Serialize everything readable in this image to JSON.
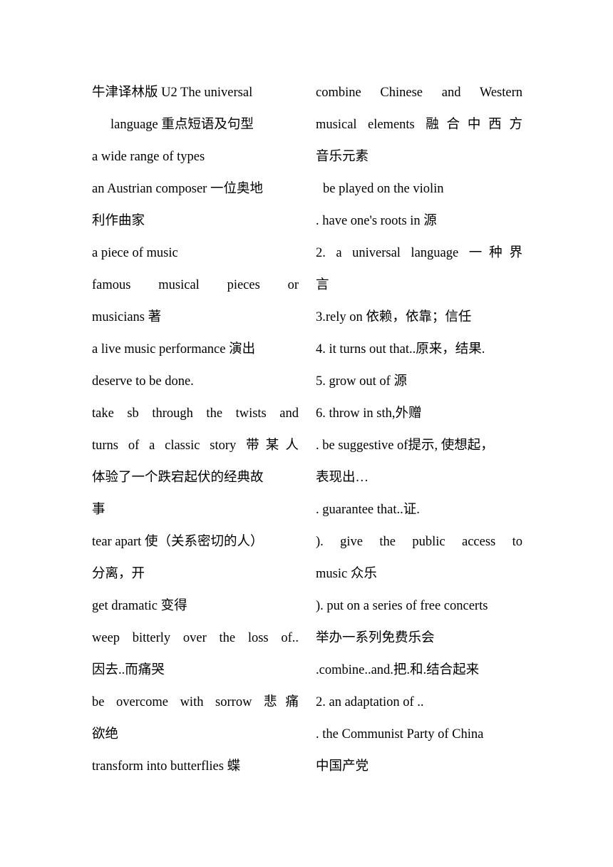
{
  "document": {
    "title_lines": [
      "牛津译林版 U2 The universal",
      "language 重点短语及句型"
    ],
    "left_column": [
      {
        "text": "牛津译林版 U2 The universal",
        "style": "title"
      },
      {
        "text": "language 重点短语及句型",
        "style": "title-indent"
      },
      {
        "text": "a wide range of types",
        "style": "plain"
      },
      {
        "text": "an Austrian composer 一位奥地",
        "style": "plain"
      },
      {
        "text": "利作曲家",
        "style": "plain"
      },
      {
        "text": "a piece of music",
        "style": "plain"
      },
      {
        "text": "famous musical pieces or",
        "style": "justify"
      },
      {
        "text": "musicians 著",
        "style": "plain"
      },
      {
        "text": "a live music performance 演出",
        "style": "plain"
      },
      {
        "text": "deserve to be done.",
        "style": "plain"
      },
      {
        "text": "take sb through the twists and",
        "style": "justify"
      },
      {
        "text": "turns of a classic story 带某人",
        "style": "justify"
      },
      {
        "text": "体验了一个跌宕起伏的经典故",
        "style": "plain"
      },
      {
        "text": "事",
        "style": "plain"
      },
      {
        "text": "tear apart 使（关系密切的人）",
        "style": "plain"
      },
      {
        "text": "分离，开",
        "style": "plain"
      },
      {
        "text": "get dramatic 变得",
        "style": "plain"
      },
      {
        "text": "weep bitterly over the loss of..",
        "style": "justify"
      },
      {
        "text": "因去..而痛哭",
        "style": "plain"
      },
      {
        "text": "be overcome with sorrow 悲痛",
        "style": "justify"
      },
      {
        "text": "欲绝",
        "style": "plain"
      },
      {
        "text": "transform into butterflies 蝶",
        "style": "plain"
      }
    ],
    "right_column": [
      {
        "text": "combine Chinese and Western",
        "style": "justify"
      },
      {
        "text": "musical elements 融合中西方",
        "style": "justify"
      },
      {
        "text": "音乐元素",
        "style": "plain"
      },
      {
        "text": "be played on the violin",
        "style": "indent-small"
      },
      {
        "text": ". have one's roots in 源",
        "style": "plain"
      },
      {
        "text": "2. a universal language 一种界",
        "style": "justify"
      },
      {
        "text": "言",
        "style": "plain"
      },
      {
        "text": "3.rely on 依赖，依靠；信任",
        "style": "plain"
      },
      {
        "text": "4. it turns out that..原来，结果.",
        "style": "plain"
      },
      {
        "text": "5. grow out of 源",
        "style": "plain"
      },
      {
        "text": "6. throw in sth,外赠",
        "style": "plain"
      },
      {
        "text": ". be suggestive of提示, 使想起，",
        "style": "plain"
      },
      {
        "text": "表现出…",
        "style": "plain"
      },
      {
        "text": ". guarantee that..证.",
        "style": "plain"
      },
      {
        "text": "). give the public access to",
        "style": "justify"
      },
      {
        "text": "music 众乐",
        "style": "plain"
      },
      {
        "text": "). put on a series of free concerts",
        "style": "plain"
      },
      {
        "text": "举办一系列免费乐会",
        "style": "plain"
      },
      {
        "text": ".combine..and.把.和.结合起来",
        "style": "plain"
      },
      {
        "text": "2. an adaptation of ..",
        "style": "plain"
      },
      {
        "text": ". the Communist Party of China",
        "style": "plain"
      },
      {
        "text": "中国产党",
        "style": "plain"
      }
    ]
  },
  "colors": {
    "background": "#ffffff",
    "text": "#000000"
  }
}
